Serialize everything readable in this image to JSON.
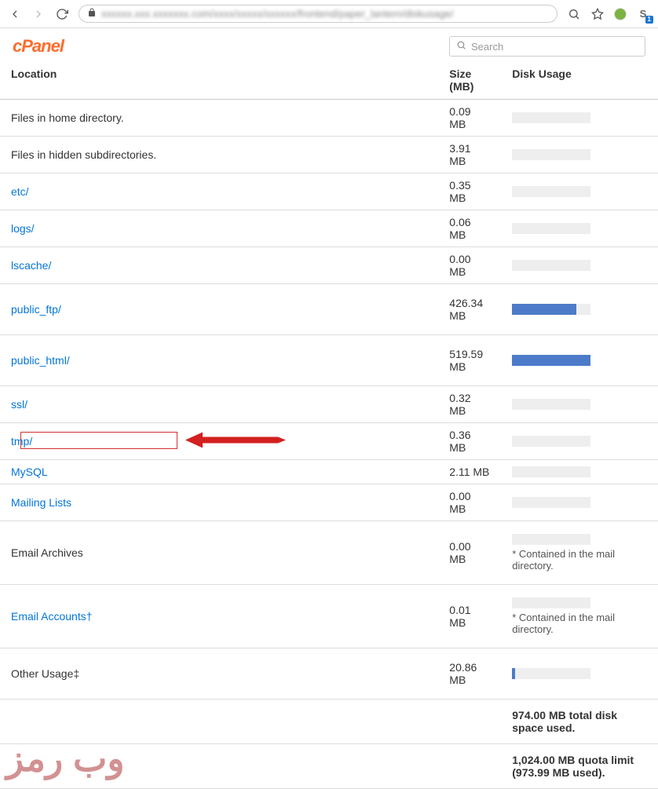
{
  "browser": {
    "url_blurred": "xxxxxx.xxx.xxxxxxx.com/xxxx/xxxxx/xxxxxx/frontend/paper_lantern/diskusage/"
  },
  "header": {
    "logo_text": "cPanel",
    "search_placeholder": "Search"
  },
  "columns": {
    "location": "Location",
    "size": "Size (MB)",
    "usage": "Disk Usage"
  },
  "rows": [
    {
      "label": "Files in home directory.",
      "isLink": false,
      "size": "0.09 MB",
      "pct": 0,
      "tall": false,
      "note": "",
      "highlight": false
    },
    {
      "label": "Files in hidden subdirectories.",
      "isLink": false,
      "size": "3.91 MB",
      "pct": 0,
      "tall": false,
      "note": "",
      "highlight": false
    },
    {
      "label": "etc/",
      "isLink": true,
      "size": "0.35 MB",
      "pct": 0,
      "tall": false,
      "note": "",
      "highlight": false
    },
    {
      "label": "logs/",
      "isLink": true,
      "size": "0.06 MB",
      "pct": 0,
      "tall": false,
      "note": "",
      "highlight": false
    },
    {
      "label": "lscache/",
      "isLink": true,
      "size": "0.00 MB",
      "pct": 0,
      "tall": false,
      "note": "",
      "highlight": false
    },
    {
      "label": "public_ftp/",
      "isLink": true,
      "size": "426.34 MB",
      "pct": 82,
      "tall": true,
      "note": "",
      "highlight": false
    },
    {
      "label": "public_html/",
      "isLink": true,
      "size": "519.59 MB",
      "pct": 100,
      "tall": true,
      "note": "",
      "highlight": false
    },
    {
      "label": "ssl/",
      "isLink": true,
      "size": "0.32 MB",
      "pct": 0,
      "tall": false,
      "note": "",
      "highlight": false
    },
    {
      "label": "tmp/",
      "isLink": true,
      "size": "0.36 MB",
      "pct": 0,
      "tall": false,
      "note": "",
      "highlight": true
    },
    {
      "label": "MySQL",
      "isLink": true,
      "size": "2.11 MB",
      "pct": 0,
      "tall": false,
      "note": "",
      "highlight": false
    },
    {
      "label": "Mailing Lists",
      "isLink": true,
      "size": "0.00 MB",
      "pct": 0,
      "tall": false,
      "note": "",
      "highlight": false
    },
    {
      "label": "Email Archives",
      "isLink": false,
      "size": "0.00 MB",
      "pct": 0,
      "tall": true,
      "note": "* Contained in the mail directory.",
      "highlight": false
    },
    {
      "label": "Email Accounts†",
      "isLink": true,
      "size": "0.01 MB",
      "pct": 0,
      "tall": true,
      "note": "* Contained in the mail directory.",
      "highlight": false
    },
    {
      "label": "Other Usage‡",
      "isLink": false,
      "size": "20.86 MB",
      "pct": 4,
      "tall": true,
      "note": "",
      "highlight": false
    }
  ],
  "totals": {
    "total": "974.00 MB total disk space used.",
    "quota": "1,024.00 MB quota limit (973.99 MB used)."
  },
  "watermark": "وب رمز"
}
